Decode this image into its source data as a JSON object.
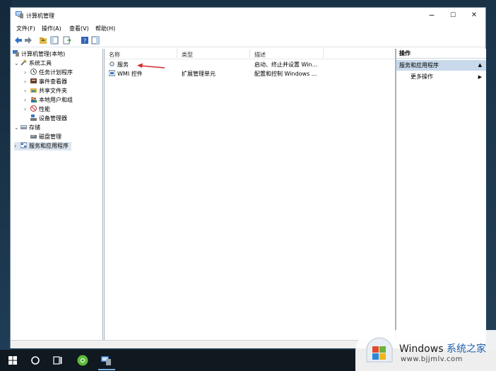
{
  "window": {
    "title": "计算机管理",
    "controls": {
      "minimize": "−",
      "maximize": "☐",
      "close": "✕"
    }
  },
  "menu": [
    "文件(F)",
    "操作(A)",
    "查看(V)",
    "帮助(H)"
  ],
  "tree": {
    "root": "计算机管理(本地)",
    "items": [
      {
        "label": "系统工具",
        "level": 1,
        "expanded": true,
        "icon": "tools-icon"
      },
      {
        "label": "任务计划程序",
        "level": 2,
        "expanded": false,
        "icon": "clock-icon"
      },
      {
        "label": "事件查看器",
        "level": 2,
        "expanded": false,
        "icon": "event-viewer-icon"
      },
      {
        "label": "共享文件夹",
        "level": 2,
        "expanded": false,
        "icon": "shared-folder-icon"
      },
      {
        "label": "本地用户和组",
        "level": 2,
        "expanded": false,
        "icon": "users-icon"
      },
      {
        "label": "性能",
        "level": 2,
        "expanded": false,
        "icon": "performance-icon"
      },
      {
        "label": "设备管理器",
        "level": 2,
        "expanded": null,
        "icon": "device-manager-icon"
      },
      {
        "label": "存储",
        "level": 1,
        "expanded": true,
        "icon": "storage-icon"
      },
      {
        "label": "磁盘管理",
        "level": 2,
        "expanded": null,
        "icon": "disk-icon"
      },
      {
        "label": "服务和应用程序",
        "level": 1,
        "expanded": false,
        "icon": "services-apps-icon",
        "selected": true
      }
    ]
  },
  "list": {
    "columns": [
      "名称",
      "类型",
      "描述"
    ],
    "rows": [
      {
        "name": "服务",
        "type": "",
        "description": "启动、终止并设置 Win..."
      },
      {
        "name": "WMI 控件",
        "type": "扩展管理单元",
        "description": "配置和控制 Windows ..."
      }
    ]
  },
  "actions": {
    "header": "操作",
    "section": "服务和应用程序",
    "more": "更多操作"
  },
  "watermark": {
    "brand": "Windows",
    "cn": "系统之家",
    "url": "www.bjjmlv.com"
  },
  "colors": {
    "selection": "#c7d9ea",
    "accent_arrow": "#d22b2b",
    "taskbar": "#101820"
  }
}
